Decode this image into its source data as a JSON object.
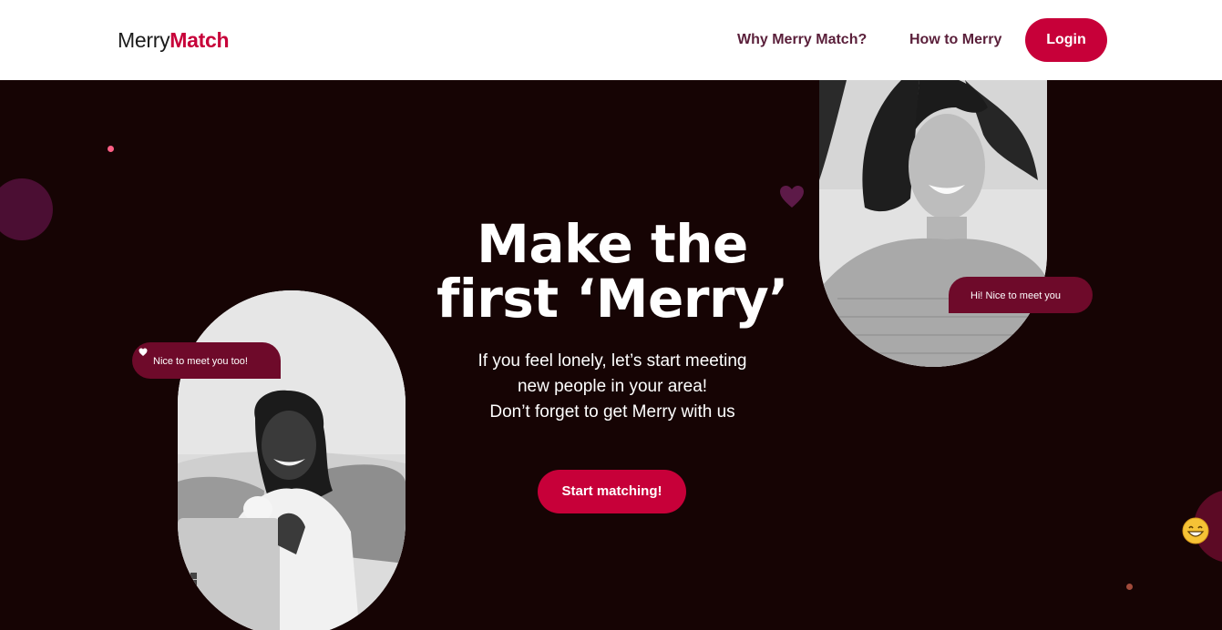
{
  "nav": {
    "logo_part1": "Merry",
    "logo_part2": "Match",
    "links": [
      {
        "label": "Why Merry Match?"
      },
      {
        "label": "How to Merry"
      }
    ],
    "login_label": "Login"
  },
  "hero": {
    "headline_line1": "Make the",
    "headline_line2": "first ‘Merry’",
    "subtext_line1": "If you feel lonely, let’s start meeting",
    "subtext_line2": "new people in your area!",
    "subtext_line3": "Don’t forget to get Merry with us",
    "cta_label": "Start matching!",
    "bubble_left": "Nice to meet you too!",
    "bubble_right": "Hi! Nice to meet you"
  },
  "colors": {
    "brand": "#c70039",
    "background": "#160404",
    "nav_link": "#5a1f3a",
    "bubble": "#6e0a2a"
  },
  "icons": [
    "heart-icon",
    "grinning-emoji-icon",
    "windows-logo-icon"
  ]
}
